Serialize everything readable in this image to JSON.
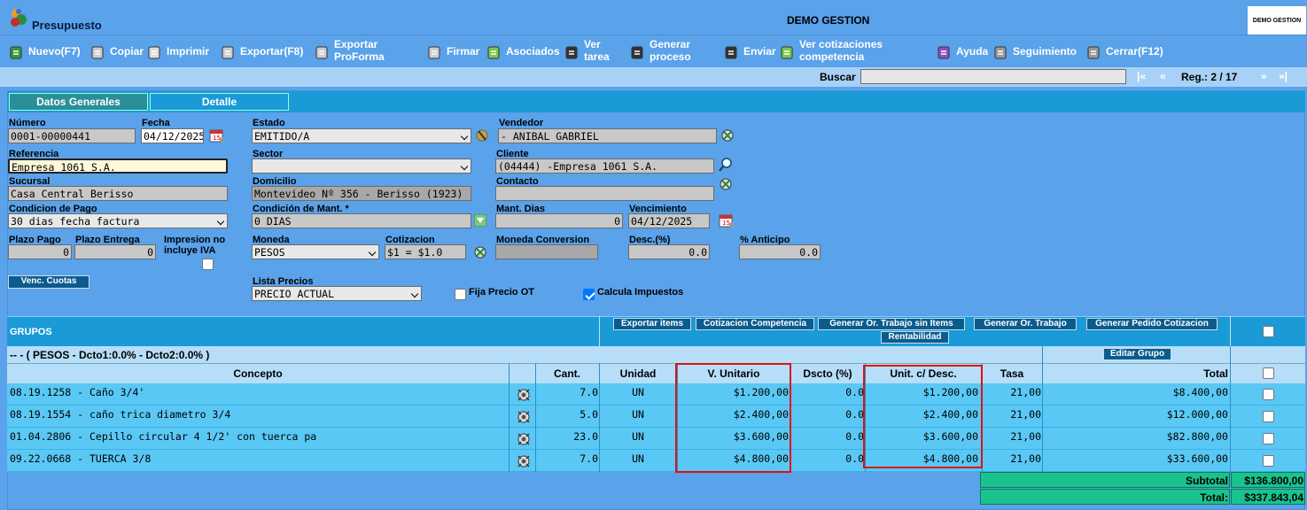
{
  "app": {
    "title": "Presupuesto",
    "center_title": "DEMO GESTION",
    "logo_text": "DEMO GESTION"
  },
  "toolbar": [
    {
      "label": "Nuevo(F7)",
      "icon": "new-icon"
    },
    {
      "label": "Copiar",
      "icon": "copy-icon"
    },
    {
      "label": "Imprimir",
      "icon": "print-icon"
    },
    {
      "label": "Exportar(F8)",
      "icon": "export-icon"
    },
    {
      "label1": "Exportar",
      "label2": "ProForma",
      "icon": "export-proforma-icon"
    },
    {
      "label": "Firmar",
      "icon": "sign-icon"
    },
    {
      "label": "Asociados",
      "icon": "associated-icon"
    },
    {
      "label1": "Ver",
      "label2": "tarea",
      "icon": "task-icon"
    },
    {
      "label1": "Generar",
      "label2": "proceso",
      "icon": "process-icon"
    },
    {
      "label": "Enviar",
      "icon": "send-icon"
    },
    {
      "label1": "Ver cotizaciones",
      "label2": "competencia",
      "icon": "quotes-icon"
    },
    {
      "label": "Ayuda",
      "icon": "help-icon"
    },
    {
      "label": "Seguimiento",
      "icon": "tracking-icon"
    },
    {
      "label": "Cerrar(F12)",
      "icon": "close-icon"
    }
  ],
  "search": {
    "label": "Buscar",
    "value": "",
    "first": "|«",
    "prev": "«",
    "reg_label": "Reg.: 2 / 17",
    "next": "»",
    "last": "»|"
  },
  "tabs": [
    "Datos Generales",
    "Detalle"
  ],
  "form": {
    "numero_label": "Número",
    "numero": "0001-00000441",
    "fecha_label": "Fecha",
    "fecha": "04/12/2025",
    "estado_label": "Estado",
    "estado": "EMITIDO/A",
    "vendedor_label": "Vendedor",
    "vendedor": "- ANIBAL GABRIEL",
    "referencia_label": "Referencia",
    "referencia": "Empresa 1061 S.A.",
    "sector_label": "Sector",
    "sector": "",
    "cliente_label": "Cliente",
    "cliente": "(04444) -Empresa 1061 S.A.",
    "sucursal_label": "Sucursal",
    "sucursal": "Casa Central Berisso",
    "domicilio_label": "Domicilio",
    "domicilio": "Montevideo Nº 356 - Berisso (1923)",
    "contacto_label": "Contacto",
    "contacto": "",
    "condpago_label": "Condicion de Pago",
    "condpago": "30 dias fecha factura",
    "condmant_label": "Condición de Mant. *",
    "condmant": "0 DIAS",
    "mantdias_label": "Mant. Dias",
    "mantdias": "0",
    "venc_label": "Vencimiento",
    "venc": "04/12/2025",
    "plazopago_label": "Plazo Pago",
    "plazopago": "0",
    "plazoentrega_label": "Plazo Entrega",
    "plazoentrega": "0",
    "impresion_label1": "Impresion no",
    "impresion_label2": "incluye IVA",
    "moneda_label": "Moneda",
    "moneda": "PESOS",
    "cotizacion_label": "Cotizacion",
    "cotizacion": "$1 = $1.0",
    "monedaconv_label": "Moneda Conversion",
    "monedaconv": "",
    "desc_label": "Desc.(%)",
    "desc": "0.0",
    "anticipo_label": "% Anticipo",
    "anticipo": "0.0",
    "venccuotas": "Venc. Cuotas",
    "lista_label": "Lista Precios",
    "lista": "PRECIO ACTUAL",
    "fijaprecio": "Fija Precio OT",
    "calculaimp": "Calcula Impuestos"
  },
  "grupos": {
    "title": "GRUPOS",
    "buttons": [
      "Exportar items",
      "Cotizacion Competencia",
      "Generar Or. Trabajo sin Items",
      "Generar Or. Trabajo",
      "Generar Pedido Cotizacion",
      "Rentabilidad"
    ],
    "group_line": "-- - ( PESOS - Dcto1:0.0% - Dcto2:0.0% )",
    "editar": "Editar Grupo"
  },
  "table": {
    "headers": [
      "Concepto",
      "Cant.",
      "Unidad",
      "V. Unitario",
      "Dscto (%)",
      "Unit. c/ Desc.",
      "Tasa",
      "Total"
    ],
    "rows": [
      {
        "concepto": "08.19.1258 - Caño 3/4'",
        "cant": "7.0",
        "unidad": "UN",
        "vunit": "$1.200,00",
        "dscto": "0.0",
        "unitdesc": "$1.200,00",
        "tasa": "21,00",
        "total": "$8.400,00"
      },
      {
        "concepto": "08.19.1554 - caño trica diametro 3/4",
        "cant": "5.0",
        "unidad": "UN",
        "vunit": "$2.400,00",
        "dscto": "0.0",
        "unitdesc": "$2.400,00",
        "tasa": "21,00",
        "total": "$12.000,00"
      },
      {
        "concepto": "01.04.2806 - Cepillo circular 4 1/2' con tuerca pa",
        "cant": "23.0",
        "unidad": "UN",
        "vunit": "$3.600,00",
        "dscto": "0.0",
        "unitdesc": "$3.600,00",
        "tasa": "21,00",
        "total": "$82.800,00"
      },
      {
        "concepto": "09.22.0668 - TUERCA 3/8",
        "cant": "7.0",
        "unidad": "UN",
        "vunit": "$4.800,00",
        "dscto": "0.0",
        "unitdesc": "$4.800,00",
        "tasa": "21,00",
        "total": "$33.600,00"
      }
    ],
    "subtotal_label": "Subtotal",
    "subtotal": "$136.800,00",
    "total_label": "Total:",
    "total": "$337.843,04"
  }
}
